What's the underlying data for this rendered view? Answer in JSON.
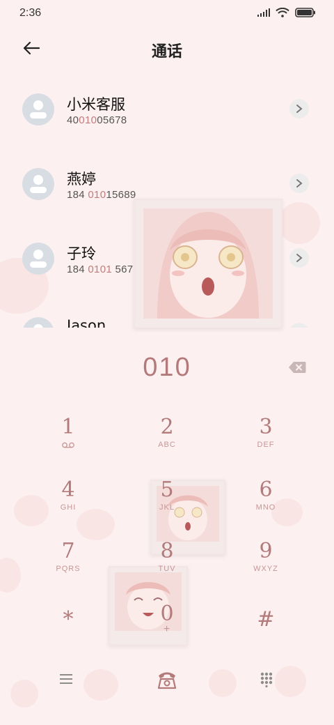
{
  "status": {
    "time": "2:36"
  },
  "header": {
    "title": "通话"
  },
  "contacts": [
    {
      "name": "小米客服",
      "num_pre": "40",
      "num_hl": "010",
      "num_post": "05678"
    },
    {
      "name": "燕婷",
      "num_pre": "184 ",
      "num_hl": "010",
      "num_post": "15689"
    },
    {
      "name": "子玲",
      "num_pre": "184 ",
      "num_hl": "0101",
      "num_post": " 5678"
    },
    {
      "name": "Jason",
      "num_pre": "",
      "num_hl": "",
      "num_post": ""
    }
  ],
  "dialer": {
    "number": "010"
  },
  "keys": [
    {
      "digit": "1",
      "letters": ""
    },
    {
      "digit": "2",
      "letters": "ABC"
    },
    {
      "digit": "3",
      "letters": "DEF"
    },
    {
      "digit": "4",
      "letters": "GHI"
    },
    {
      "digit": "5",
      "letters": "JKL"
    },
    {
      "digit": "6",
      "letters": "MNO"
    },
    {
      "digit": "7",
      "letters": "PQRS"
    },
    {
      "digit": "8",
      "letters": "TUV"
    },
    {
      "digit": "9",
      "letters": "WXYZ"
    },
    {
      "digit": "*",
      "letters": ""
    },
    {
      "digit": "0",
      "letters": "+"
    },
    {
      "digit": "#",
      "letters": ""
    }
  ],
  "icons": {
    "back": "back-arrow-icon",
    "chevron": "chevron-right-icon",
    "backspace": "backspace-icon",
    "voicemail": "voicemail-icon",
    "menu": "menu-icon",
    "call": "phone-icon",
    "keypad": "keypad-icon"
  },
  "colors": {
    "background": "#fdf0f0",
    "accent": "#b27a7a",
    "highlight": "#c27c7c"
  }
}
